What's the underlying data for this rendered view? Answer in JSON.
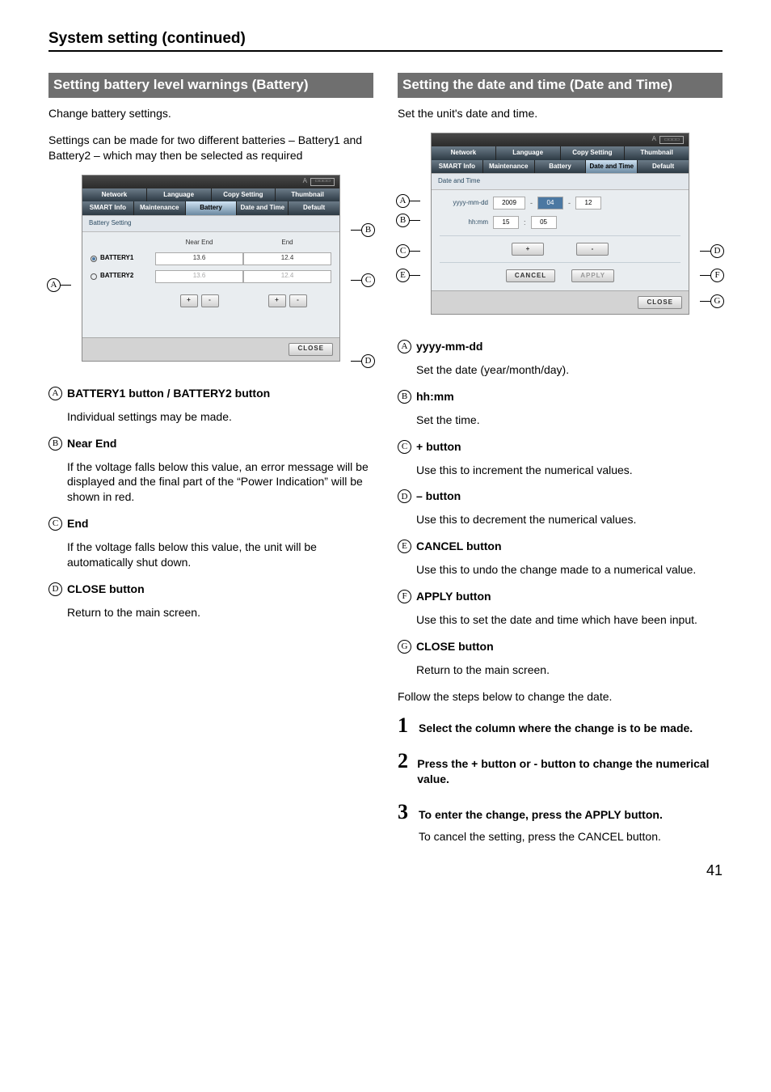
{
  "page": {
    "header": "System setting (continued)",
    "number": "41"
  },
  "battery": {
    "bar": "Setting battery level warnings (Battery)",
    "intro1": "Change battery settings.",
    "intro2": "Settings can be made for two different batteries – Battery1 and Battery2 – which may then be selected as required",
    "panel": {
      "subhdr": "Battery Setting",
      "col_near": "Near End",
      "col_end": "End",
      "opt1": "BATTERY1",
      "opt2": "BATTERY2",
      "v1near": "13.6",
      "v1end": "12.4",
      "v2near": "13.6",
      "v2end": "12.4",
      "plus": "+",
      "minus": "-",
      "close": "CLOSE"
    },
    "defs": {
      "A": {
        "t": "BATTERY1 button / BATTERY2 button",
        "b": "Individual settings may be made."
      },
      "B": {
        "t": "Near End",
        "b": "If the voltage falls below this value, an error message will be displayed and the final part of the “Power Indication” will be shown in red."
      },
      "C": {
        "t": "End",
        "b": "If the voltage falls below this value, the unit will be automatically shut down."
      },
      "D": {
        "t": "CLOSE button",
        "b": "Return to the main screen."
      }
    }
  },
  "datetime": {
    "bar": "Setting the date and time (Date and Time)",
    "intro": "Set the unit's date and time.",
    "panel": {
      "subhdr": "Date and Time",
      "l_date": "yyyy-mm-dd",
      "l_time": "hh:mm",
      "yyyy": "2009",
      "mm": "04",
      "dd": "12",
      "hh": "15",
      "mi": "05",
      "cancel": "CANCEL",
      "apply": "APPLY",
      "close": "CLOSE"
    },
    "defs": {
      "A": {
        "t": "yyyy-mm-dd",
        "b": "Set the date (year/month/day)."
      },
      "B": {
        "t": "hh:mm",
        "b": "Set the time."
      },
      "C": {
        "t": "+ button",
        "b": "Use this to increment the numerical values."
      },
      "D": {
        "t": "– button",
        "b": "Use this to decrement the numerical values."
      },
      "E": {
        "t": "CANCEL button",
        "b": "Use this to undo the change made to a numerical value."
      },
      "F": {
        "t": "APPLY button",
        "b": "Use this to set the date and time which have been input."
      },
      "G": {
        "t": "CLOSE button",
        "b": "Return to the main screen."
      }
    },
    "follow": "Follow the steps below to change the date.",
    "steps": {
      "s1": "Select the column where the change is to be made.",
      "s2": "Press the + button or - button to change the numerical value.",
      "s3": "To enter the change, press the APPLY button.",
      "s3b": "To cancel the setting, press the CANCEL button."
    }
  },
  "tabs": {
    "r1": [
      "Network",
      "Language",
      "Copy Setting",
      "Thumbnail"
    ],
    "r2": [
      "SMART Info",
      "Maintenance",
      "Battery",
      "Date and Time",
      "Default"
    ]
  },
  "kb": "⌨"
}
